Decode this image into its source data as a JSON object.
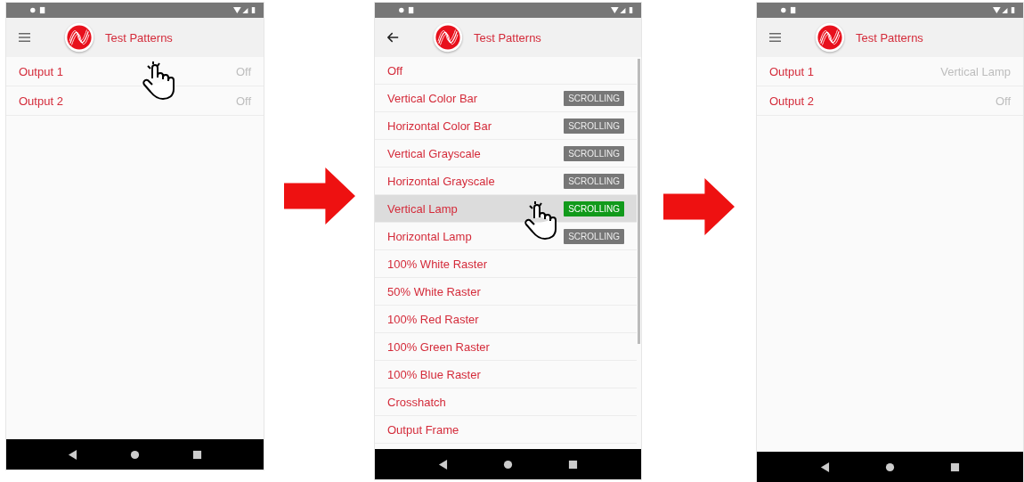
{
  "screens": [
    {
      "navigation": {
        "kind": "menu"
      },
      "title": "Test Patterns",
      "kind": "outputs",
      "items": [
        {
          "label": "Output 1",
          "value": "Off",
          "tapped": true
        },
        {
          "label": "Output 2",
          "value": "Off",
          "tapped": false
        }
      ]
    },
    {
      "navigation": {
        "kind": "back"
      },
      "title": "Test Patterns",
      "kind": "patterns",
      "items": [
        {
          "label": "Off",
          "selected": false,
          "tapped": false
        },
        {
          "label": "Vertical Color Bar",
          "badge": "SCROLLING",
          "selected": false,
          "tapped": false
        },
        {
          "label": "Horizontal Color Bar",
          "badge": "SCROLLING",
          "selected": false,
          "tapped": false
        },
        {
          "label": "Vertical Grayscale",
          "badge": "SCROLLING",
          "selected": false,
          "tapped": false
        },
        {
          "label": "Horizontal Grayscale",
          "badge": "SCROLLING",
          "selected": false,
          "tapped": false
        },
        {
          "label": "Vertical Lamp",
          "badge": "SCROLLING",
          "selected": true,
          "tapped": true
        },
        {
          "label": "Horizontal Lamp",
          "badge": "SCROLLING",
          "selected": false,
          "tapped": false
        },
        {
          "label": "100% White Raster",
          "selected": false,
          "tapped": false
        },
        {
          "label": "50% White Raster",
          "selected": false,
          "tapped": false
        },
        {
          "label": "100% Red Raster",
          "selected": false,
          "tapped": false
        },
        {
          "label": "100% Green Raster",
          "selected": false,
          "tapped": false
        },
        {
          "label": "100% Blue Raster",
          "selected": false,
          "tapped": false
        },
        {
          "label": "Crosshatch",
          "selected": false,
          "tapped": false
        },
        {
          "label": "Output Frame",
          "selected": false,
          "tapped": false
        }
      ]
    },
    {
      "navigation": {
        "kind": "menu"
      },
      "title": "Test Patterns",
      "kind": "outputs",
      "items": [
        {
          "label": "Output 1",
          "value": "Vertical Lamp",
          "tapped": false
        },
        {
          "label": "Output 2",
          "value": "Off",
          "tapped": false
        }
      ]
    }
  ]
}
